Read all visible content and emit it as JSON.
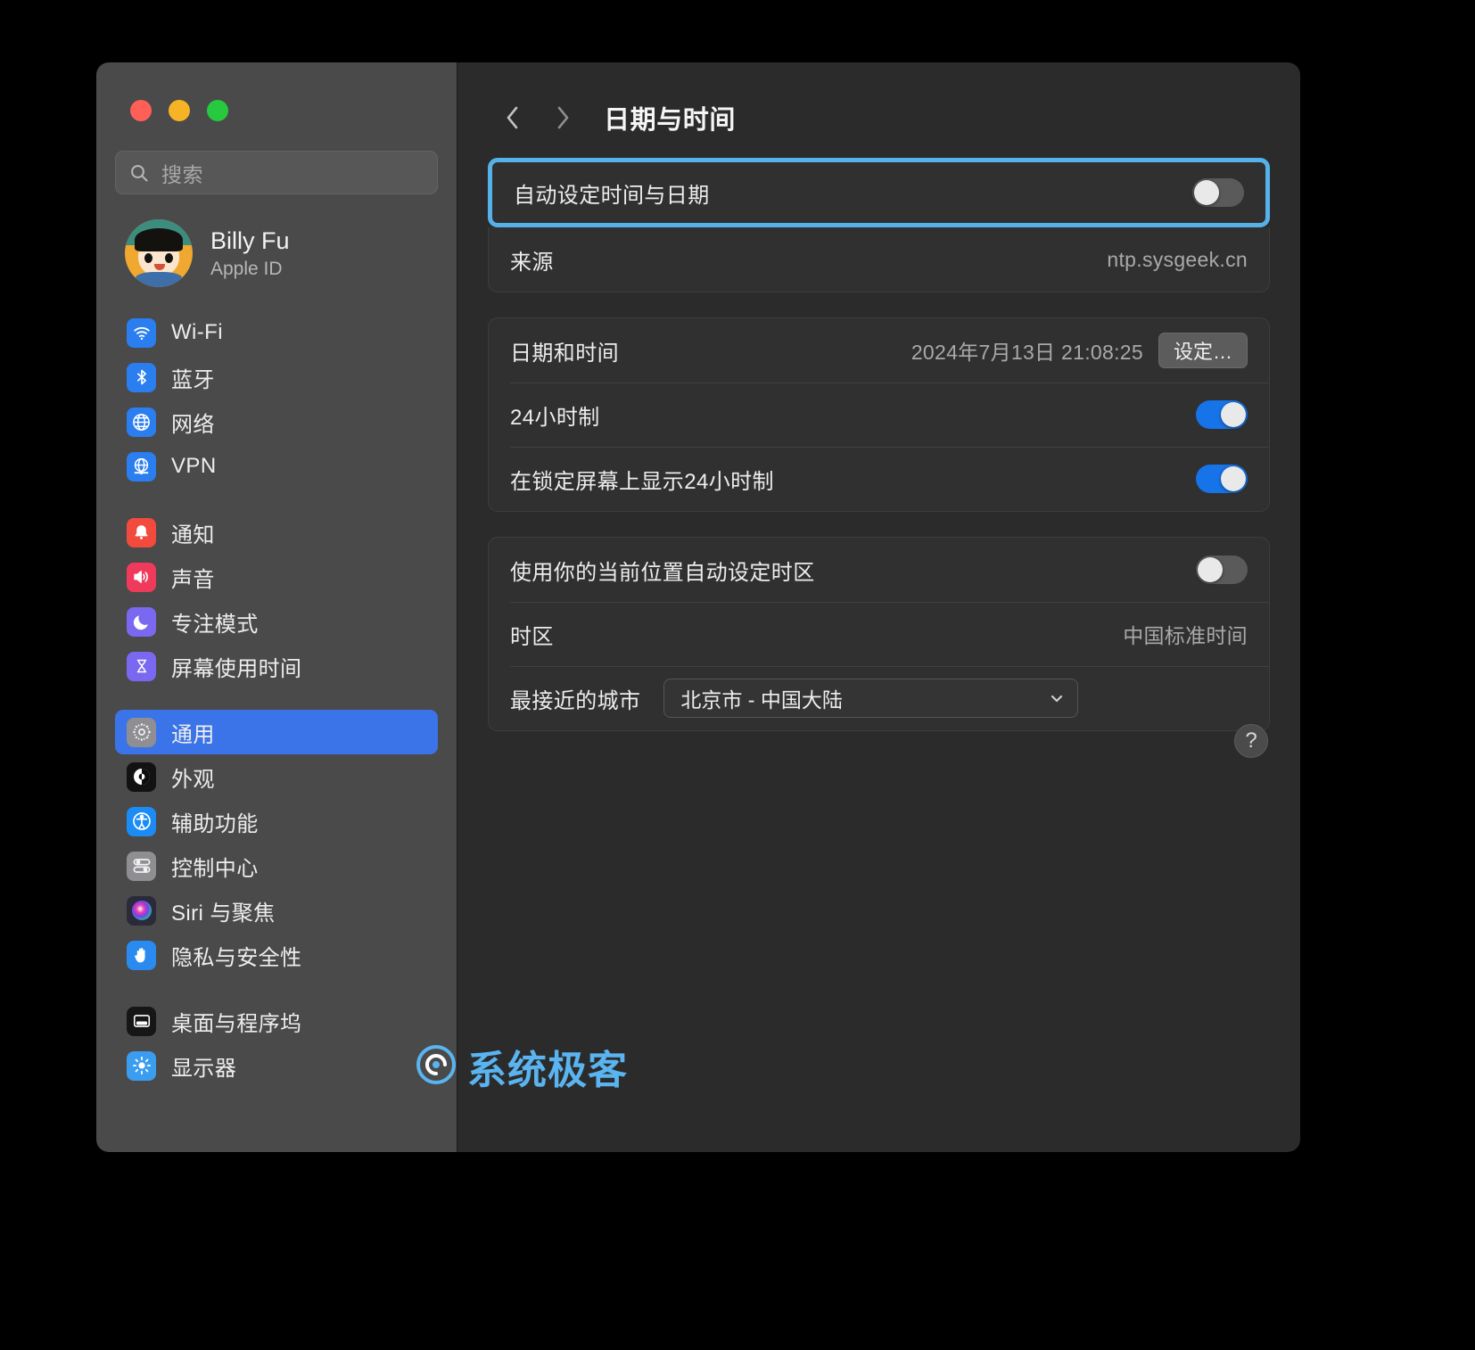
{
  "window": {
    "traffic_lights": [
      "close",
      "minimize",
      "zoom"
    ]
  },
  "sidebar": {
    "search": {
      "placeholder": "搜索",
      "icon": "search-icon"
    },
    "profile": {
      "name": "Billy Fu",
      "subtitle": "Apple ID",
      "avatar": "memoji-avatar"
    },
    "groups": [
      {
        "items": [
          {
            "label": "Wi-Fi",
            "icon": "wifi-icon",
            "color": "#2a7ef0",
            "selected": false
          },
          {
            "label": "蓝牙",
            "icon": "bluetooth-icon",
            "color": "#2a7ef0",
            "selected": false
          },
          {
            "label": "网络",
            "icon": "globe-icon",
            "color": "#2a7ef0",
            "selected": false
          },
          {
            "label": "VPN",
            "icon": "vpn-globe-icon",
            "color": "#2a7ef0",
            "selected": false
          }
        ]
      },
      {
        "items": [
          {
            "label": "通知",
            "icon": "bell-icon",
            "color": "#f24a3d",
            "selected": false
          },
          {
            "label": "声音",
            "icon": "speaker-icon",
            "color": "#f03a5c",
            "selected": false
          },
          {
            "label": "专注模式",
            "icon": "moon-icon",
            "color": "#7b68f0",
            "selected": false
          },
          {
            "label": "屏幕使用时间",
            "icon": "hourglass-icon",
            "color": "#7b68f0",
            "selected": false
          }
        ]
      },
      {
        "items": [
          {
            "label": "通用",
            "icon": "gear-icon",
            "color": "#8e8e93",
            "selected": true
          },
          {
            "label": "外观",
            "icon": "appearance-icon",
            "color": "#121212",
            "selected": false
          },
          {
            "label": "辅助功能",
            "icon": "accessibility-icon",
            "color": "#1b8cf5",
            "selected": false
          },
          {
            "label": "控制中心",
            "icon": "control-center-icon",
            "color": "#8e8e93",
            "selected": false
          },
          {
            "label": "Siri 与聚焦",
            "icon": "siri-icon",
            "color": "#2a2a3a",
            "selected": false
          },
          {
            "label": "隐私与安全性",
            "icon": "hand-icon",
            "color": "#2a8af0",
            "selected": false
          }
        ]
      },
      {
        "items": [
          {
            "label": "桌面与程序坞",
            "icon": "desktop-dock-icon",
            "color": "#161616",
            "selected": false
          },
          {
            "label": "显示器",
            "icon": "display-icon",
            "color": "#3b9df0",
            "selected": false
          }
        ]
      }
    ]
  },
  "header": {
    "back_icon": "chevron-left-icon",
    "forward_icon": "chevron-right-icon",
    "title": "日期与时间"
  },
  "main": {
    "auto_section": {
      "auto_set_label": "自动设定时间与日期",
      "auto_set_toggle": "off",
      "focus_highlight_color": "#56b1e8",
      "source_label": "来源",
      "source_value": "ntp.sysgeek.cn"
    },
    "datetime_section": {
      "datetime_label": "日期和时间",
      "datetime_value": "2024年7月13日 21:08:25",
      "set_button_label": "设定…",
      "hour24_label": "24小时制",
      "hour24_toggle": "on",
      "lockscreen24_label": "在锁定屏幕上显示24小时制",
      "lockscreen24_toggle": "on"
    },
    "timezone_section": {
      "auto_timezone_label": "使用你的当前位置自动设定时区",
      "auto_timezone_toggle": "off",
      "timezone_label": "时区",
      "timezone_value": "中国标准时间",
      "closest_city_label": "最接近的城市",
      "closest_city_value": "北京市 - 中国大陆",
      "dropdown_icon": "chevron-down-icon"
    },
    "help_button_label": "?"
  },
  "watermark": {
    "text": "系统极客",
    "icon": "spiral-logo-icon",
    "color": "#5ab4ef"
  }
}
